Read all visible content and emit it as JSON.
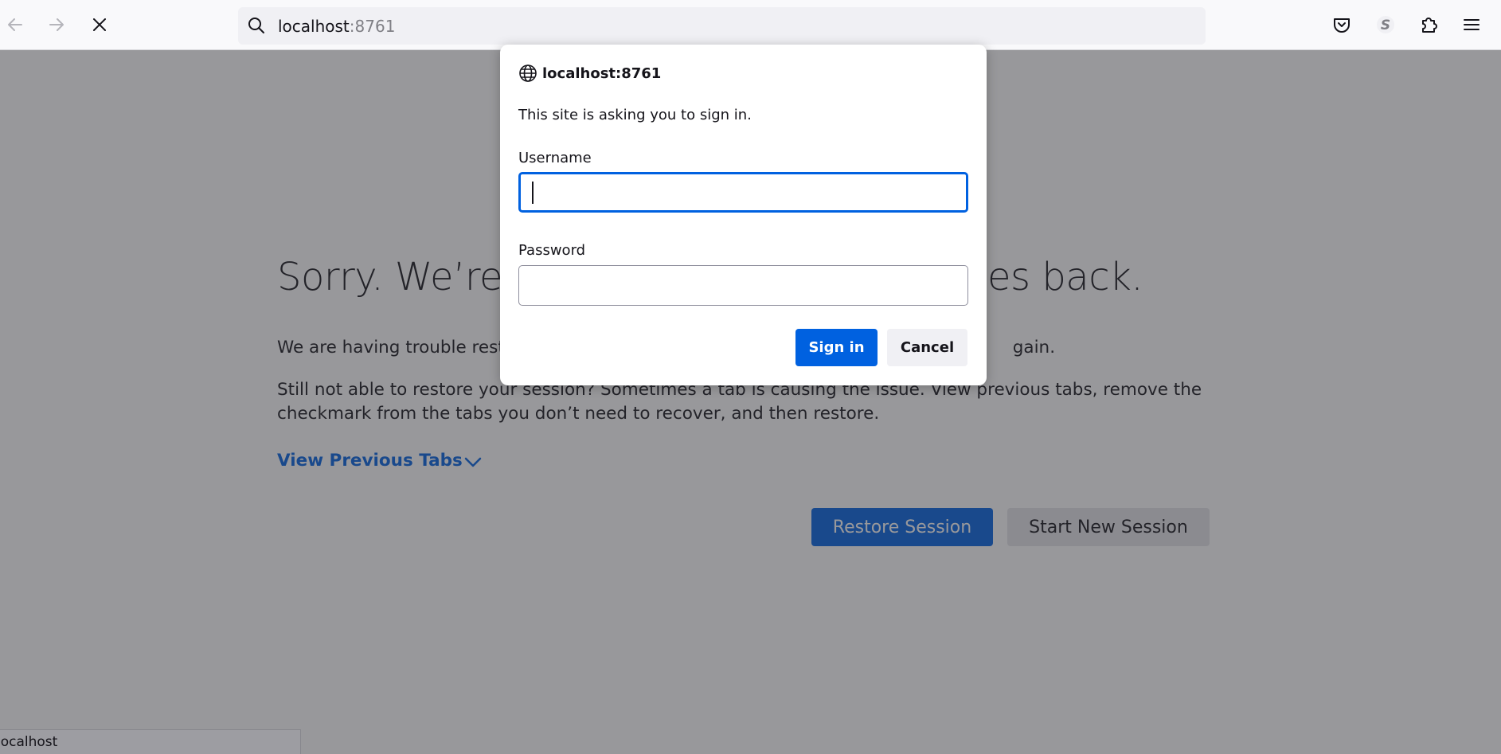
{
  "browser": {
    "url_host": "localhost",
    "url_port": ":8761",
    "status_text": "localhost",
    "icons": [
      "back-icon",
      "forward-icon",
      "stop-icon",
      "search-icon",
      "pocket-icon",
      "sync-icon",
      "extensions-icon",
      "menu-icon"
    ]
  },
  "page": {
    "headline_left": "Sorry. We’re h",
    "headline_right": "ges back.",
    "para1_left": "We are having trouble restor",
    "para1_right": "gain.",
    "para2": "Still not able to restore your session? Sometimes a tab is causing the issue. View previous tabs, remove the checkmark from the tabs you don’t need to recover, and then restore.",
    "view_previous_tabs": "View Previous Tabs",
    "restore_session": "Restore Session",
    "start_new_session": "Start New Session"
  },
  "dialog": {
    "host": "localhost:8761",
    "message": "This site is asking you to sign in.",
    "username_label": "Username",
    "username_value": "",
    "password_label": "Password",
    "password_value": "",
    "sign_in": "Sign in",
    "cancel": "Cancel"
  },
  "colors": {
    "accent": "#0061e0",
    "overlay": "rgba(50,50,56,0.5)"
  }
}
